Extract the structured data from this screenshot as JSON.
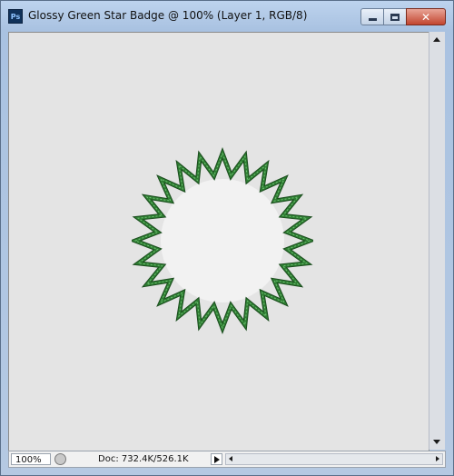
{
  "window": {
    "title": "Glossy Green Star Badge @ 100% (Layer 1, RGB/8)",
    "app_icon_text": "Ps"
  },
  "canvas": {
    "background_color": "#e4e4e4",
    "shape": {
      "type": "star-ring",
      "points": 24,
      "stroke_color": "#2e7d32",
      "fill_color": "#f2f2f2"
    }
  },
  "status": {
    "zoom": "100%",
    "doc_info": "Doc: 732.4K/526.1K"
  },
  "icons": {
    "minimize": "minimize-icon",
    "maximize": "maximize-icon",
    "close": "close-icon",
    "status_menu": "status-menu-icon",
    "play": "play-icon"
  }
}
